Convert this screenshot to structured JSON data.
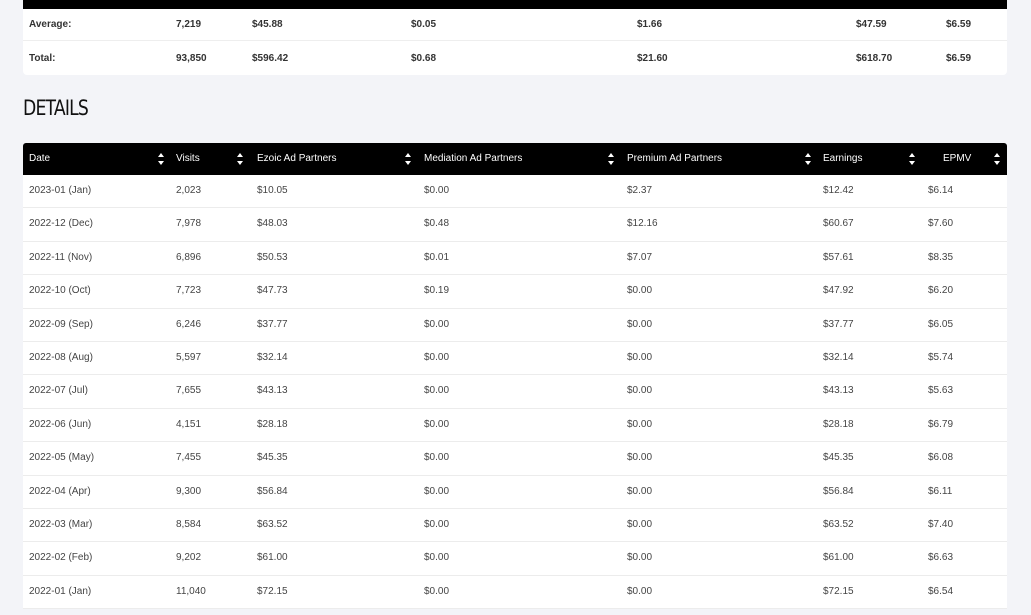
{
  "summary": {
    "rows": [
      {
        "label": "Average:",
        "visits": "7,219",
        "ezoic": "$45.88",
        "mediation": "$0.05",
        "premium": "$1.66",
        "earnings": "$47.59",
        "epmv": "$6.59"
      },
      {
        "label": "Total:",
        "visits": "93,850",
        "ezoic": "$596.42",
        "mediation": "$0.68",
        "premium": "$21.60",
        "earnings": "$618.70",
        "epmv": "$6.59"
      }
    ]
  },
  "details": {
    "heading": "DETAILS",
    "columns": [
      "Date",
      "Visits",
      "Ezoic Ad Partners",
      "Mediation Ad Partners",
      "Premium Ad Partners",
      "Earnings",
      "EPMV"
    ],
    "rows": [
      [
        "2023-01 (Jan)",
        "2,023",
        "$10.05",
        "$0.00",
        "$2.37",
        "$12.42",
        "$6.14"
      ],
      [
        "2022-12 (Dec)",
        "7,978",
        "$48.03",
        "$0.48",
        "$12.16",
        "$60.67",
        "$7.60"
      ],
      [
        "2022-11 (Nov)",
        "6,896",
        "$50.53",
        "$0.01",
        "$7.07",
        "$57.61",
        "$8.35"
      ],
      [
        "2022-10 (Oct)",
        "7,723",
        "$47.73",
        "$0.19",
        "$0.00",
        "$47.92",
        "$6.20"
      ],
      [
        "2022-09 (Sep)",
        "6,246",
        "$37.77",
        "$0.00",
        "$0.00",
        "$37.77",
        "$6.05"
      ],
      [
        "2022-08 (Aug)",
        "5,597",
        "$32.14",
        "$0.00",
        "$0.00",
        "$32.14",
        "$5.74"
      ],
      [
        "2022-07 (Jul)",
        "7,655",
        "$43.13",
        "$0.00",
        "$0.00",
        "$43.13",
        "$5.63"
      ],
      [
        "2022-06 (Jun)",
        "4,151",
        "$28.18",
        "$0.00",
        "$0.00",
        "$28.18",
        "$6.79"
      ],
      [
        "2022-05 (May)",
        "7,455",
        "$45.35",
        "$0.00",
        "$0.00",
        "$45.35",
        "$6.08"
      ],
      [
        "2022-04 (Apr)",
        "9,300",
        "$56.84",
        "$0.00",
        "$0.00",
        "$56.84",
        "$6.11"
      ],
      [
        "2022-03 (Mar)",
        "8,584",
        "$63.52",
        "$0.00",
        "$0.00",
        "$63.52",
        "$7.40"
      ],
      [
        "2022-02 (Feb)",
        "9,202",
        "$61.00",
        "$0.00",
        "$0.00",
        "$61.00",
        "$6.63"
      ],
      [
        "2022-01 (Jan)",
        "11,040",
        "$72.15",
        "$0.00",
        "$0.00",
        "$72.15",
        "$6.54"
      ]
    ]
  }
}
